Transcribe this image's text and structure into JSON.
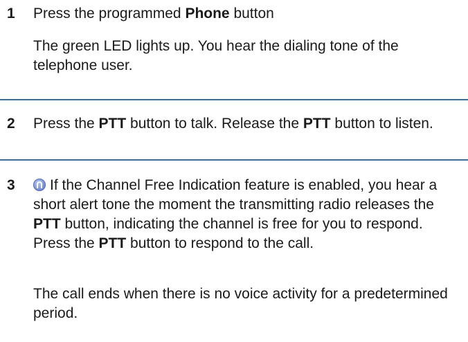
{
  "steps": [
    {
      "number": "1",
      "instruction": {
        "pre": "Press the programmed ",
        "bold": "Phone",
        "post": " button"
      },
      "result": "The green LED lights up. You hear the dialing tone of the telephone user."
    },
    {
      "number": "2",
      "instruction": {
        "t1": "Press the ",
        "b1": "PTT",
        "t2": " button to talk. Release the ",
        "b2": "PTT",
        "t3": " button to listen."
      }
    },
    {
      "number": "3",
      "note_icon": "accessory-note-icon",
      "instruction": {
        "t1": "If the Channel Free Indication feature is enabled, you hear a short alert tone the moment the transmitting radio releases the ",
        "b1": "PTT",
        "t2": " button, indicating the channel is free for you to respond. Press the ",
        "b2": "PTT",
        "t3": " button to respond to the call."
      },
      "result": "The call ends when there is no voice activity for a predetermined period."
    }
  ],
  "colors": {
    "divider": "#3d6f9a",
    "text": "#1a1a1a"
  }
}
